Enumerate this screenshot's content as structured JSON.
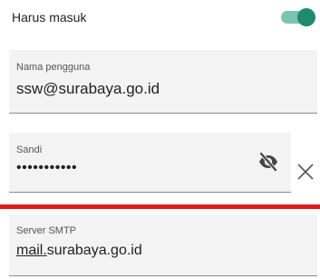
{
  "toggle": {
    "label": "Harus masuk",
    "on": true,
    "accent": "#1f8a6d"
  },
  "username": {
    "label": "Nama pengguna",
    "value": "ssw@surabaya.go.id"
  },
  "password": {
    "label": "Sandi",
    "value": "•••••••••••",
    "visibility_icon": "eye-off-icon",
    "clear_icon": "close-icon"
  },
  "smtp": {
    "label": "Server SMTP",
    "value_prefix": "mail.",
    "value_rest": "surabaya.go.id"
  },
  "colors": {
    "divider": "#e31b1b"
  }
}
